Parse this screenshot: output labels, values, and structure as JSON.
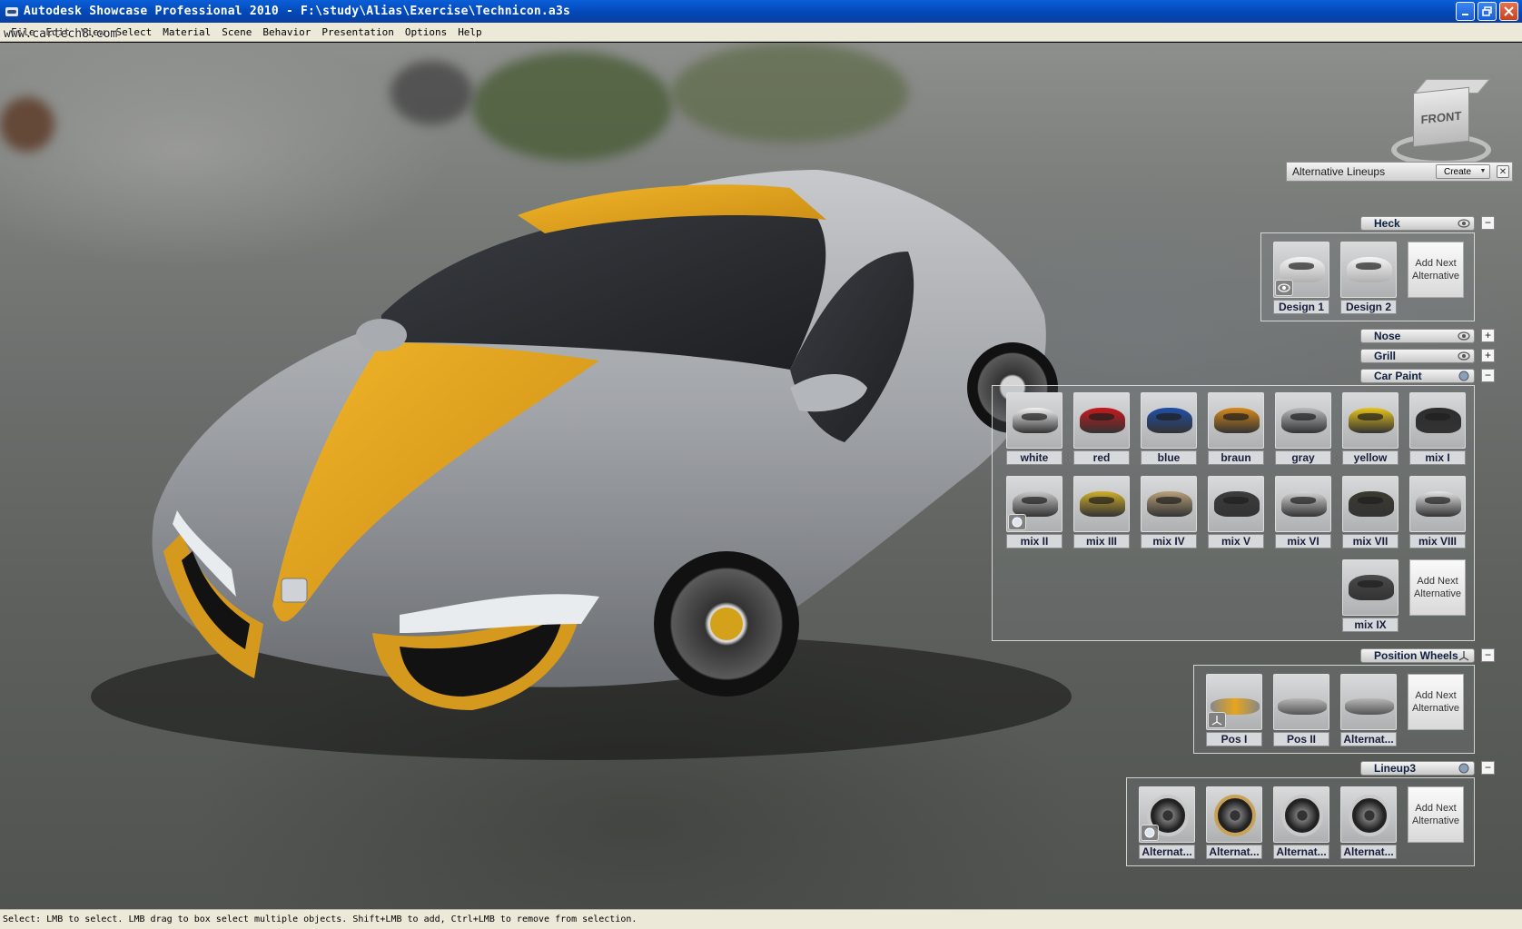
{
  "window": {
    "title": "Autodesk Showcase Professional 2010 - F:\\study\\Alias\\Exercise\\Technicon.a3s",
    "watermark": "www.cartech8.com"
  },
  "menu": [
    "File",
    "Edit",
    "View",
    "Select",
    "Material",
    "Scene",
    "Behavior",
    "Presentation",
    "Options",
    "Help"
  ],
  "viewcube": {
    "face_label": "FRONT"
  },
  "panel": {
    "title": "Alternative Lineups",
    "create_label": "Create",
    "add_next_label": "Add Next Alternative",
    "groups": [
      {
        "label": "Heck",
        "toggle": "−",
        "tiles": [
          "Design 1",
          "Design 2"
        ]
      },
      {
        "label": "Nose",
        "toggle": "+"
      },
      {
        "label": "Grill",
        "toggle": "+"
      },
      {
        "label": "Car Paint",
        "toggle": "−",
        "tiles": [
          "white",
          "red",
          "blue",
          "braun",
          "gray",
          "yellow",
          "mix I",
          "mix II",
          "mix III",
          "mix IV",
          "mix V",
          "mix VI",
          "mix VII",
          "mix VIII",
          "mix IX"
        ]
      },
      {
        "label": "Position Wheels",
        "toggle": "−",
        "tiles": [
          "Pos I",
          "Pos II",
          "Alternat..."
        ]
      },
      {
        "label": "Lineup3",
        "toggle": "−",
        "tiles": [
          "Alternat...",
          "Alternat...",
          "Alternat...",
          "Alternat..."
        ]
      }
    ]
  },
  "colors": {
    "paint": [
      "#f2f2f2",
      "#c8171b",
      "#1f4fa8",
      "#d88a1a",
      "#b9bbbd",
      "#e8c419",
      "#2d2d2d",
      "#c9c9c9",
      "#cfae2a",
      "#b9a07a",
      "#3c3c3c",
      "#d8d8d8",
      "#3b3a30",
      "#e5e5e5",
      "#4a4a4a"
    ],
    "stripe": "#e7a51c",
    "body": "#9c9fa3"
  },
  "status": {
    "text": "Select: LMB to select. LMB drag to box select multiple objects. Shift+LMB to add, Ctrl+LMB to remove from selection."
  }
}
